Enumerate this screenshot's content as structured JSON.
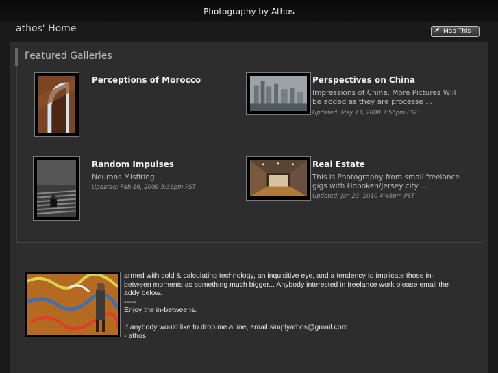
{
  "header": {
    "title": "Photography by Athos"
  },
  "nav": {
    "home_link": "athos' Home",
    "map_button": "Map This"
  },
  "featured": {
    "heading": "Featured Galleries",
    "galleries": [
      {
        "title": "Perceptions of Morocco",
        "description": "",
        "updated": ""
      },
      {
        "title": "Perspectives on China",
        "description": "Impressions of China. More Pictures Will be added as they are processe ...",
        "updated": "Updated: May 13, 2008 7:56pm PST"
      },
      {
        "title": "Random Impulses",
        "description": "Neurons Misfiring...",
        "updated": "Updated: Feb 16, 2009 5:33pm PST"
      },
      {
        "title": "Real Estate",
        "description": "This is Photography from small freelance gigs with Hoboken/Jersey city ...",
        "updated": "Updated: Jan 23, 2010 4:46pm PST"
      }
    ]
  },
  "bio": {
    "lines": [
      "armed with cold & calculating technology, an inquisitive eye, and a tendency to implicate those in-",
      "between moments as something much bigger... Anybody interested in freelance work please email the",
      "addy below.",
      "-----",
      "Enjoy the in-betweens.",
      "",
      "If anybody would like to drop me a line, email simplyathos@gmail.com",
      "- athos"
    ]
  }
}
